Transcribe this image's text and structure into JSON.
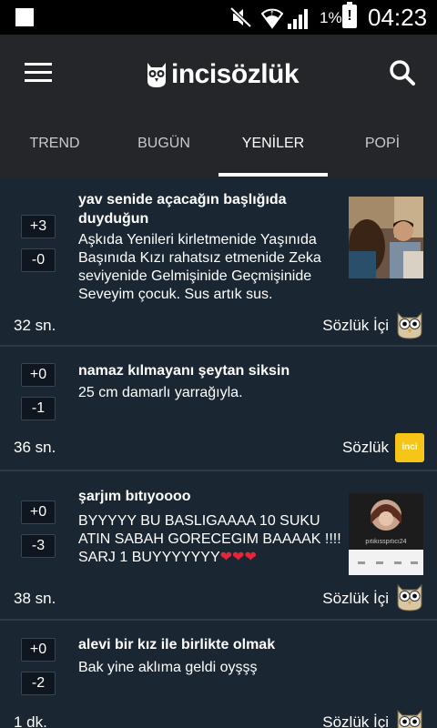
{
  "status_bar": {
    "battery_percent": "1%",
    "battery_alert": "!",
    "clock": "04:23"
  },
  "app_bar": {
    "logo_text": "incisözlük",
    "tabs": [
      {
        "label": "TREND",
        "active": false
      },
      {
        "label": "BUGÜN",
        "active": false
      },
      {
        "label": "YENİLER",
        "active": true
      },
      {
        "label": "POPİ",
        "active": false
      }
    ]
  },
  "entries": [
    {
      "up_vote": "+3",
      "down_vote": "-0",
      "title_lines": [
        "yav senide açacağın başlığıda",
        "duyduğun"
      ],
      "body_lines": [
        "Aşkıda Yenileri kirletmenide Yaşınıda",
        "Başınıda Kızı rahatsız etmenide Zeka",
        "seviyenide Gelmişinide Geçmişinide",
        "Seveyim çocuk. Sus artık sus."
      ],
      "time": "32 sn.",
      "source": "Sözlük İçi",
      "badge_icon": "owl-icon",
      "has_thumbnail": true
    },
    {
      "up_vote": "+0",
      "down_vote": "-1",
      "title_lines": [
        "namaz kılmayanı şeytan siksin"
      ],
      "body_lines": [
        "25 cm damarlı yarrağıyla."
      ],
      "time": "36 sn.",
      "source": "Sözlük",
      "badge_icon": "inci-logo-icon",
      "badge_text": "inci",
      "has_thumbnail": false
    },
    {
      "up_vote": "+0",
      "down_vote": "-3",
      "title_lines": [
        "şarjım bıtıyoooo"
      ],
      "body_lines": [
        "BYYYYY BU BASLIGAAAA 10 SUKU",
        "ATIN SABAH GORECEGIM BAAAAK !!!!",
        "SARJ 1 BUYYYYYYY"
      ],
      "hearts": "❤❤❤",
      "time": "38 sn.",
      "source": "Sözlük İçi",
      "badge_icon": "owl-icon",
      "has_thumbnail": true,
      "thumb_caption": "pıtıkısspıtıcı24"
    },
    {
      "up_vote": "+0",
      "down_vote": "-2",
      "title_lines": [
        "alevi bir kız ile birlikte olmak"
      ],
      "body_lines": [
        "Bak yine aklıma geldi oyşşş"
      ],
      "time": "1 dk.",
      "source": "Sözlük İçi",
      "badge_icon": "owl-icon",
      "has_thumbnail": false
    }
  ]
}
